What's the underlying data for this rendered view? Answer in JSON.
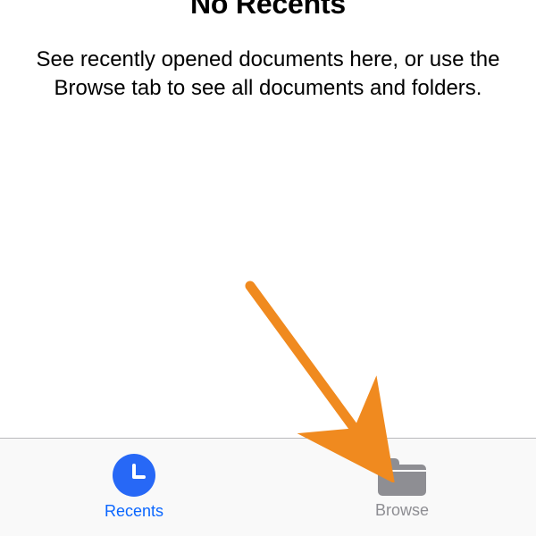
{
  "empty_state": {
    "title": "No Recents",
    "subtitle": "See recently opened documents here, or use the Browse tab to see all documents and folders."
  },
  "tabbar": {
    "recents": {
      "label": "Recents"
    },
    "browse": {
      "label": "Browse"
    }
  },
  "annotation": {
    "color": "#f08a1f"
  }
}
